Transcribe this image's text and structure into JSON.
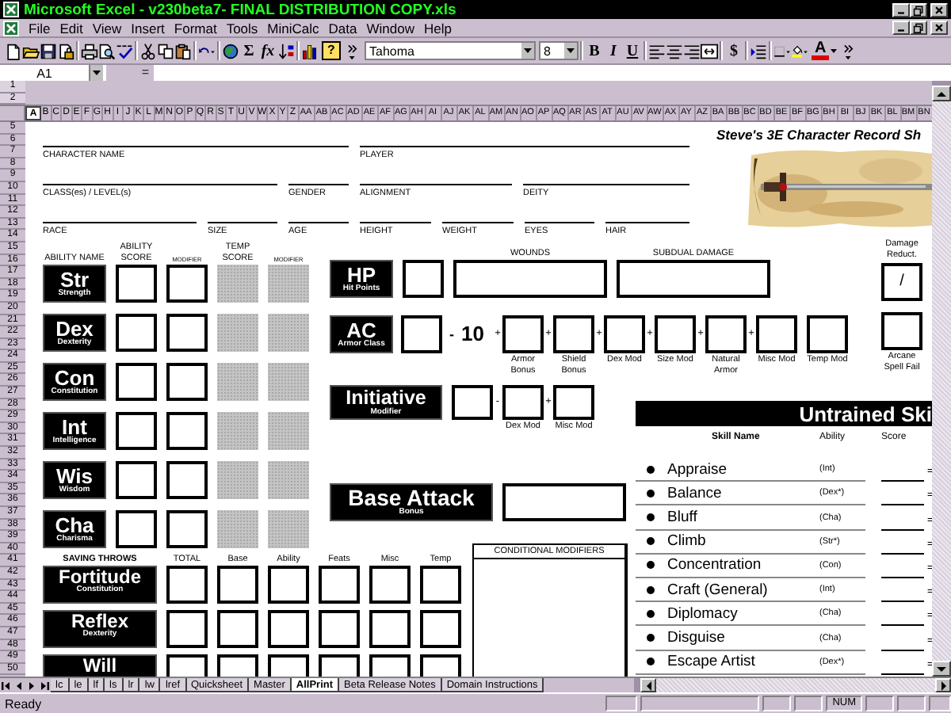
{
  "window": {
    "title": "Microsoft Excel - v230beta7- FINAL DISTRIBUTION COPY.xls"
  },
  "menu": [
    "File",
    "Edit",
    "View",
    "Insert",
    "Format",
    "Tools",
    "MiniCalc",
    "Data",
    "Window",
    "Help"
  ],
  "toolbar": [
    {
      "kind": "new"
    },
    {
      "kind": "open"
    },
    {
      "kind": "save"
    },
    {
      "kind": "permission"
    },
    {
      "kind": "separator"
    },
    {
      "kind": "print"
    },
    {
      "kind": "preview"
    },
    {
      "kind": "spelling"
    },
    {
      "kind": "separator"
    },
    {
      "kind": "cut"
    },
    {
      "kind": "copy"
    },
    {
      "kind": "paste"
    },
    {
      "kind": "separator"
    },
    {
      "kind": "undo"
    },
    {
      "kind": "separator"
    },
    {
      "kind": "web"
    },
    {
      "kind": "bold",
      "label": "Σ"
    },
    {
      "kind": "italic",
      "label": "fx"
    },
    {
      "kind": "sort"
    },
    {
      "kind": "separator"
    },
    {
      "kind": "chart"
    },
    {
      "kind": "help",
      "label": "?"
    },
    {
      "kind": "more"
    },
    {
      "kind": "font_box",
      "value": "Tahoma"
    },
    {
      "kind": "size_box",
      "value": "8"
    },
    {
      "kind": "separator"
    },
    {
      "kind": "bold",
      "label": "B"
    },
    {
      "kind": "italic",
      "label": "I"
    },
    {
      "kind": "underline",
      "label": "U"
    },
    {
      "kind": "separator"
    },
    {
      "kind": "align_left"
    },
    {
      "kind": "align_center"
    },
    {
      "kind": "align_right"
    },
    {
      "kind": "merge"
    },
    {
      "kind": "separator"
    },
    {
      "kind": "bold",
      "label": "$"
    },
    {
      "kind": "separator"
    },
    {
      "kind": "indent"
    },
    {
      "kind": "separator"
    },
    {
      "kind": "borders"
    },
    {
      "kind": "fill_color"
    },
    {
      "kind": "font_color",
      "label": "A"
    },
    {
      "kind": "more"
    }
  ],
  "formula_bar": {
    "name_box": "A1",
    "equals": "="
  },
  "frozen_rows": [
    "1",
    "2"
  ],
  "columns": [
    {
      "label": "A",
      "selected": true
    },
    {
      "label": "B",
      "selected": false
    },
    {
      "label": "C",
      "selected": false
    },
    {
      "label": "D",
      "selected": false
    },
    {
      "label": "E",
      "selected": false
    },
    {
      "label": "F",
      "selected": false
    },
    {
      "label": "G",
      "selected": false
    },
    {
      "label": "H",
      "selected": false
    },
    {
      "label": "I",
      "selected": false
    },
    {
      "label": "J",
      "selected": false
    },
    {
      "label": "K",
      "selected": false
    },
    {
      "label": "L",
      "selected": false
    },
    {
      "label": "M",
      "selected": false
    },
    {
      "label": "N",
      "selected": false
    },
    {
      "label": "O",
      "selected": false
    },
    {
      "label": "P",
      "selected": false
    },
    {
      "label": "Q",
      "selected": false
    },
    {
      "label": "R",
      "selected": false
    },
    {
      "label": "S",
      "selected": false
    },
    {
      "label": "T",
      "selected": false
    },
    {
      "label": "U",
      "selected": false
    },
    {
      "label": "V",
      "selected": false
    },
    {
      "label": "W",
      "selected": false
    },
    {
      "label": "X",
      "selected": false
    },
    {
      "label": "Y",
      "selected": false
    },
    {
      "label": "Z",
      "selected": false
    },
    {
      "label": "AA",
      "selected": false
    },
    {
      "label": "AB",
      "selected": false
    },
    {
      "label": "AC",
      "selected": false
    },
    {
      "label": "AD",
      "selected": false
    },
    {
      "label": "AE",
      "selected": false
    },
    {
      "label": "AF",
      "selected": false
    },
    {
      "label": "AG",
      "selected": false
    },
    {
      "label": "AH",
      "selected": false
    },
    {
      "label": "AI",
      "selected": false
    },
    {
      "label": "AJ",
      "selected": false
    },
    {
      "label": "AK",
      "selected": false
    },
    {
      "label": "AL",
      "selected": false
    },
    {
      "label": "AM",
      "selected": false
    },
    {
      "label": "AN",
      "selected": false
    },
    {
      "label": "AO",
      "selected": false
    },
    {
      "label": "AP",
      "selected": false
    },
    {
      "label": "AQ",
      "selected": false
    },
    {
      "label": "AR",
      "selected": false
    },
    {
      "label": "AS",
      "selected": false
    },
    {
      "label": "AT",
      "selected": false
    },
    {
      "label": "AU",
      "selected": false
    },
    {
      "label": "AV",
      "selected": false
    },
    {
      "label": "AW",
      "selected": false
    },
    {
      "label": "AX",
      "selected": false
    },
    {
      "label": "AY",
      "selected": false
    },
    {
      "label": "AZ",
      "selected": false
    },
    {
      "label": "BA",
      "selected": false
    },
    {
      "label": "BB",
      "selected": false
    },
    {
      "label": "BC",
      "selected": false
    },
    {
      "label": "BD",
      "selected": false
    },
    {
      "label": "BE",
      "selected": false
    },
    {
      "label": "BF",
      "selected": false
    },
    {
      "label": "BG",
      "selected": false
    },
    {
      "label": "BH",
      "selected": false
    },
    {
      "label": "BI",
      "selected": false
    },
    {
      "label": "BJ",
      "selected": false
    },
    {
      "label": "BK",
      "selected": false
    },
    {
      "label": "BL",
      "selected": false
    },
    {
      "label": "BM",
      "selected": false
    },
    {
      "label": "BN",
      "selected": false
    }
  ],
  "rows": [
    "5",
    "6",
    "7",
    "8",
    "9",
    "10",
    "11",
    "12",
    "13",
    "14",
    "15",
    "16",
    "17",
    "18",
    "19",
    "20",
    "21",
    "22",
    "23",
    "24",
    "25",
    "26",
    "27",
    "28",
    "29",
    "30",
    "31",
    "32",
    "33",
    "34",
    "35",
    "36",
    "37",
    "38",
    "39",
    "40",
    "41",
    "42",
    "43",
    "44",
    "45",
    "46",
    "47",
    "48",
    "49",
    "50"
  ],
  "sheet": {
    "title": "Steve's 3E Character Record Sh",
    "logo": {
      "kind": "picture"
    },
    "info_rows": [
      [
        "CHARACTER NAME",
        "PLAYER"
      ],
      [
        "CLASS(es) / LEVEL(s)",
        "GENDER",
        "ALIGNMENT",
        "DEITY"
      ],
      [
        "RACE",
        "SIZE",
        "AGE",
        "HEIGHT",
        "WEIGHT",
        "EYES",
        "HAIR"
      ]
    ],
    "ability_headers": [
      "ABILITY NAME",
      "ABILITY SCORE",
      "MODIFIER",
      "TEMP SCORE",
      "MODIFIER"
    ],
    "abilities": [
      {
        "abbr": "Str",
        "name": "Strength"
      },
      {
        "abbr": "Dex",
        "name": "Dexterity"
      },
      {
        "abbr": "Con",
        "name": "Constitution"
      },
      {
        "abbr": "Int",
        "name": "Intelligence"
      },
      {
        "abbr": "Wis",
        "name": "Wisdom"
      },
      {
        "abbr": "Cha",
        "name": "Charisma"
      }
    ],
    "hp": {
      "abbr": "HP",
      "name": "Hit Points",
      "wounds_label": "WOUNDS",
      "subdual_label": "SUBDUAL DAMAGE"
    },
    "damage_reduction": {
      "label": "Damage Reduct.",
      "value": "/"
    },
    "arcane_spell_failure": {
      "label": "Arcane Spell Fail"
    },
    "ac": {
      "abbr": "AC",
      "name": "Armor Class",
      "minus": "-",
      "base": "10",
      "components": [
        {
          "label": "Armor Bonus",
          "sign": "+"
        },
        {
          "label": "Shield Bonus",
          "sign": "+"
        },
        {
          "label": "Dex Mod",
          "sign": "+"
        },
        {
          "label": "Size Mod",
          "sign": "+"
        },
        {
          "label": "Natural Armor",
          "sign": "+"
        },
        {
          "label": "Misc Mod",
          "sign": "+"
        },
        {
          "label": "Temp Mod"
        }
      ]
    },
    "initiative": {
      "title": "Initiative",
      "subtitle": "Modifier",
      "components": [
        {
          "label": "Dex Mod",
          "sign": "-"
        },
        {
          "label": "Misc Mod",
          "sign": "+"
        }
      ]
    },
    "base_attack": {
      "title": "Base Attack",
      "subtitle": "Bonus"
    },
    "conditional_modifiers": {
      "title": "CONDITIONAL MODIFIERS"
    },
    "saving_throws": {
      "title": "SAVING THROWS",
      "columns": [
        "TOTAL",
        "Base",
        "Ability",
        "Feats",
        "Misc",
        "Temp"
      ],
      "saves": [
        {
          "name": "Fortitude",
          "ability": "Constitution"
        },
        {
          "name": "Reflex",
          "ability": "Dexterity"
        },
        {
          "name": "Will"
        }
      ]
    },
    "skills": {
      "title": "Untrained Ski",
      "columns": [
        "Skill Name",
        "Ability",
        "Score"
      ],
      "items": [
        {
          "name": "Appraise",
          "ability": "(Int)",
          "equals": "="
        },
        {
          "name": "Balance",
          "ability": "(Dex*)",
          "equals": "="
        },
        {
          "name": "Bluff",
          "ability": "(Cha)",
          "equals": "="
        },
        {
          "name": "Climb",
          "ability": "(Str*)",
          "equals": "="
        },
        {
          "name": "Concentration",
          "ability": "(Con)",
          "equals": "="
        },
        {
          "name": "Craft (General)",
          "ability": "(Int)",
          "equals": "="
        },
        {
          "name": "Diplomacy",
          "ability": "(Cha)",
          "equals": "="
        },
        {
          "name": "Disguise",
          "ability": "(Cha)",
          "equals": "="
        },
        {
          "name": "Escape Artist",
          "ability": "(Dex*)",
          "equals": "="
        }
      ]
    }
  },
  "sheet_tabs": [
    {
      "label": "lc",
      "selected": false
    },
    {
      "label": "le",
      "selected": false
    },
    {
      "label": "lf",
      "selected": false
    },
    {
      "label": "ls",
      "selected": false
    },
    {
      "label": "lr",
      "selected": false
    },
    {
      "label": "lw",
      "selected": false
    },
    {
      "label": "lref",
      "selected": false
    },
    {
      "label": "Quicksheet",
      "selected": false
    },
    {
      "label": "Master",
      "selected": false
    },
    {
      "label": "AllPrint",
      "selected": true
    },
    {
      "label": "Beta Release Notes",
      "selected": false
    },
    {
      "label": "Domain Instructions",
      "selected": false
    }
  ],
  "status_bar": {
    "text": "Ready",
    "indicators": [
      "NUM"
    ]
  }
}
